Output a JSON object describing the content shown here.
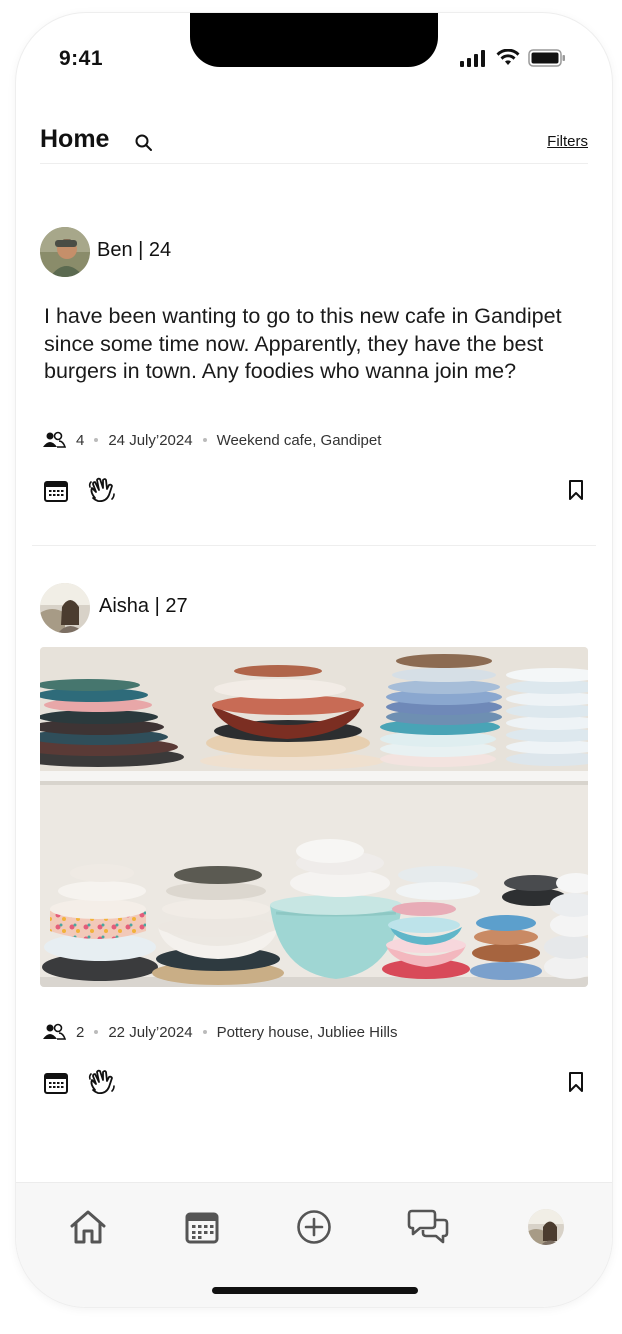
{
  "status_bar": {
    "time": "9:41"
  },
  "header": {
    "title": "Home",
    "filters_label": "Filters"
  },
  "posts": [
    {
      "author": "Ben | 24",
      "text": "I have been wanting to go to this new cafe in Gandipet since some time now. Apparently, they have the best burgers in town. Any foodies who wanna join me?",
      "people_count": "4",
      "date": "24 July’2024",
      "location": "Weekend cafe, Gandipet"
    },
    {
      "author": "Aisha | 27",
      "people_count": "2",
      "date": "22 July’2024",
      "location": "Pottery house, Jubliee Hills"
    }
  ],
  "tabbar": {
    "items": [
      "home-icon",
      "calendar-icon",
      "add-icon",
      "chat-icon",
      "profile-avatar"
    ]
  },
  "colors": {
    "text": "#111111",
    "divider": "#eeeeee",
    "tabbar_bg": "#f7f7f7"
  }
}
